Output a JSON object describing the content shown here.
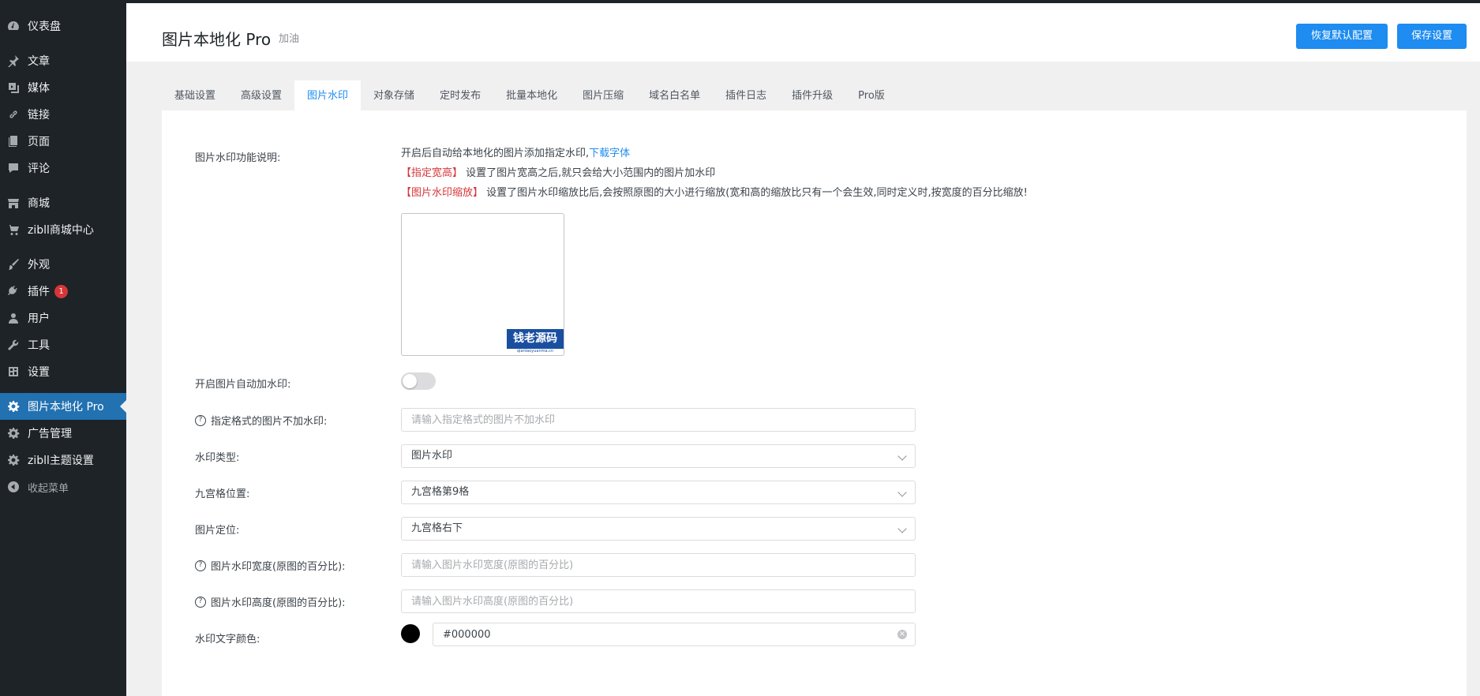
{
  "sidebar": {
    "items": [
      {
        "label": "仪表盘",
        "icon": "dashboard-icon"
      },
      {
        "label": "文章",
        "icon": "pin-icon"
      },
      {
        "label": "媒体",
        "icon": "media-icon"
      },
      {
        "label": "链接",
        "icon": "link-icon"
      },
      {
        "label": "页面",
        "icon": "page-icon"
      },
      {
        "label": "评论",
        "icon": "comment-icon"
      },
      {
        "label": "商城",
        "icon": "store-icon"
      },
      {
        "label": "zibll商城中心",
        "icon": "cart-icon"
      },
      {
        "label": "外观",
        "icon": "brush-icon"
      },
      {
        "label": "插件",
        "icon": "plugin-icon",
        "badge": "1"
      },
      {
        "label": "用户",
        "icon": "user-icon"
      },
      {
        "label": "工具",
        "icon": "wrench-icon"
      },
      {
        "label": "设置",
        "icon": "settings-icon"
      },
      {
        "label": "图片本地化 Pro",
        "icon": "gear-icon",
        "active": true
      },
      {
        "label": "广告管理",
        "icon": "gear-icon"
      },
      {
        "label": "zibll主题设置",
        "icon": "gear-icon"
      },
      {
        "label": "收起菜单",
        "icon": "collapse-icon"
      }
    ]
  },
  "header": {
    "title": "图片本地化 Pro",
    "subtitle": "加油",
    "reset_label": "恢复默认配置",
    "save_label": "保存设置"
  },
  "tabs": [
    {
      "label": "基础设置"
    },
    {
      "label": "高级设置"
    },
    {
      "label": "图片水印",
      "active": true
    },
    {
      "label": "对象存储"
    },
    {
      "label": "定时发布"
    },
    {
      "label": "批量本地化"
    },
    {
      "label": "图片压缩"
    },
    {
      "label": "域名白名单"
    },
    {
      "label": "插件日志"
    },
    {
      "label": "插件升级"
    },
    {
      "label": "Pro版"
    }
  ],
  "form": {
    "desc_label": "图片水印功能说明:",
    "desc_line1": "开启后自动给本地化的图片添加指定水印,",
    "desc_link": "下载字体",
    "desc_line2_tag": "【指定宽高】",
    "desc_line2": " 设置了图片宽高之后,就只会给大小范围内的图片加水印",
    "desc_line3_tag": "【图片水印缩放】",
    "desc_line3": " 设置了图片水印缩放比后,会按照原图的大小进行缩放(宽和高的缩放比只有一个会生效,同时定义时,按宽度的百分比缩放!",
    "watermark_text": "钱老源码",
    "watermark_small": "qianlaoyuanma.cn",
    "toggle_label": "开启图片自动加水印:",
    "toggle_on": false,
    "exclude_label": "指定格式的图片不加水印:",
    "exclude_placeholder": "请输入指定格式的图片不加水印",
    "type_label": "水印类型:",
    "type_value": "图片水印",
    "grid_label": "九宫格位置:",
    "grid_value": "九宫格第9格",
    "pos_label": "图片定位:",
    "pos_value": "九宫格右下",
    "width_label": "图片水印宽度(原图的百分比):",
    "width_placeholder": "请输入图片水印宽度(原图的百分比)",
    "height_label": "图片水印高度(原图的百分比):",
    "height_placeholder": "请输入图片水印高度(原图的百分比)",
    "color_label": "水印文字颜色:",
    "color_value": "#000000"
  }
}
